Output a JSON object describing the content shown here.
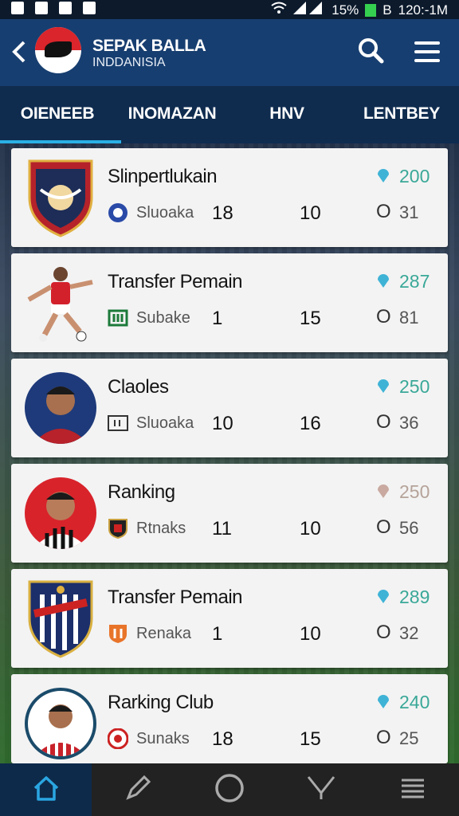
{
  "status": {
    "battery": "15%",
    "time": "120:-1M",
    "b": "B"
  },
  "app": {
    "title": "SEPAK BALLA",
    "subtitle": "INDDANISIA"
  },
  "tabs": [
    "OIENEEB",
    "INOMAZAN",
    "HNV",
    "LENTBEY"
  ],
  "cards": [
    {
      "title": "Slinpertlukain",
      "club": "Sluoaka",
      "v1": "18",
      "v2": "10",
      "score": "200",
      "o": "O",
      "o2": "31",
      "score_color": "#3aa898",
      "pin_color": "#3fb3d6"
    },
    {
      "title": "Transfer Pemain",
      "club": "Subake",
      "v1": "1",
      "v2": "15",
      "score": "287",
      "o": "O",
      "o2": "81",
      "score_color": "#3aa898",
      "pin_color": "#3fb3d6"
    },
    {
      "title": "Claoles",
      "club": "Sluoaka",
      "v1": "10",
      "v2": "16",
      "score": "250",
      "o": "O",
      "o2": "36",
      "score_color": "#3aa898",
      "pin_color": "#3fb3d6"
    },
    {
      "title": "Ranking",
      "club": "Rtnaks",
      "v1": "11",
      "v2": "10",
      "score": "250",
      "o": "O",
      "o2": "56",
      "score_color": "#b5a39a",
      "pin_color": "#c9a9a0"
    },
    {
      "title": "Transfer Pemain",
      "club": "Renaka",
      "v1": "1",
      "v2": "10",
      "score": "289",
      "o": "O",
      "o2": "32",
      "score_color": "#3aa898",
      "pin_color": "#3fb3d6"
    },
    {
      "title": "Rarking Club",
      "club": "Sunaks",
      "v1": "18",
      "v2": "15",
      "score": "240",
      "o": "O",
      "o2": "25",
      "score_color": "#3aa898",
      "pin_color": "#3fb3d6"
    }
  ],
  "nav": [
    "home-icon",
    "edit-icon",
    "circle-icon",
    "whistle-icon",
    "menu-icon"
  ]
}
